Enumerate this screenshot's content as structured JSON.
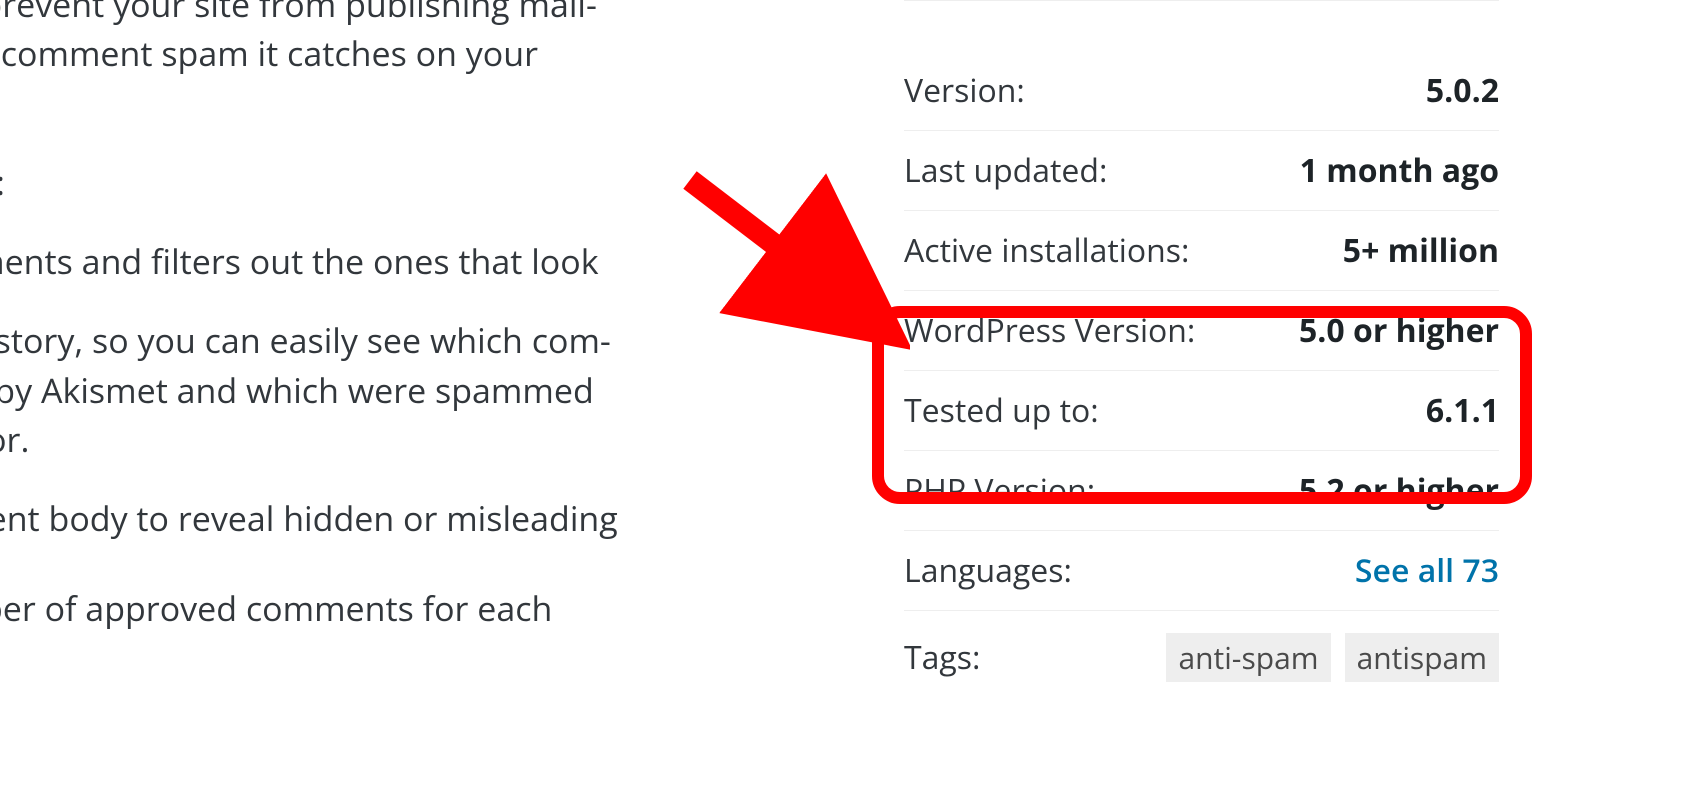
{
  "description": {
    "paragraph1": "pam to prevent your site from publishing mali­view the comment spam it catches on your ­ screen.",
    "paragraph_include": "t include:",
    "bullet1": "all comments and filters out the ones that look",
    "bullet2": "status history, so you can easily see which com­ cleared by Akismet and which were spammed noderator.",
    "bullet3": "e comment body to reveal hidden or misleading",
    "bullet4": "ne number of approved comments for each"
  },
  "sidebar": {
    "version_label": "Version:",
    "version_value": "5.0.2",
    "last_updated_label": "Last updated:",
    "last_updated_value": "1 month ago",
    "active_installs_label": "Active installations:",
    "active_installs_value": "5+ million",
    "wp_version_label": "WordPress Version:",
    "wp_version_value": "5.0 or higher",
    "tested_label": "Tested up to:",
    "tested_value": "6.1.1",
    "php_label": "PHP Version:",
    "php_value": "5.2 or higher",
    "languages_label": "Languages:",
    "languages_link": "See all 73",
    "tags_label": "Tags:",
    "tag1": "anti-spam",
    "tag2": "antispam"
  }
}
